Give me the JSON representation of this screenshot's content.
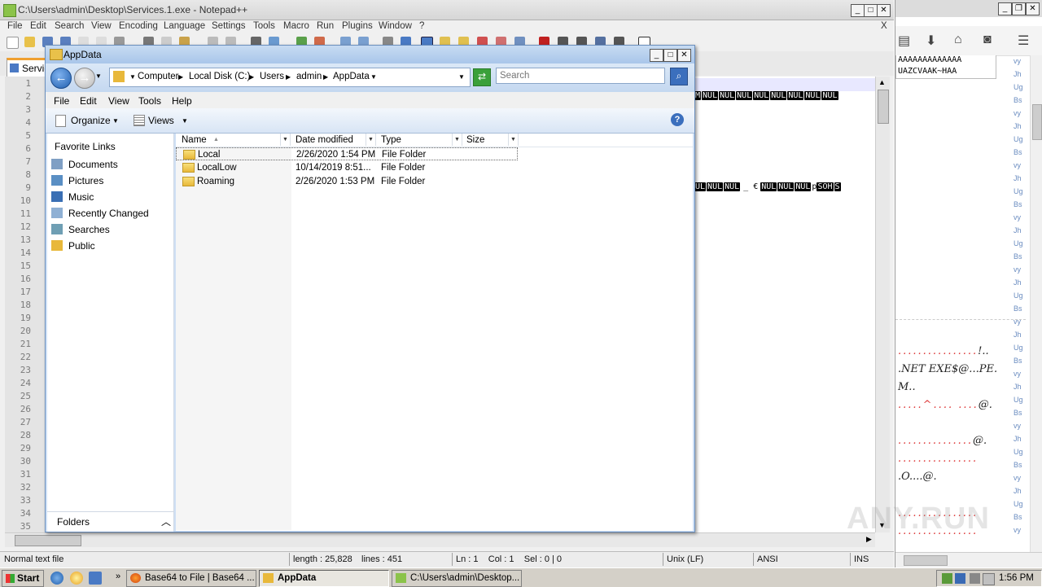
{
  "notepad": {
    "title": "C:\\Users\\admin\\Desktop\\Services.1.exe - Notepad++",
    "menu": [
      "File",
      "Edit",
      "Search",
      "View",
      "Encoding",
      "Language",
      "Settings",
      "Tools",
      "Macro",
      "Run",
      "Plugins",
      "Window",
      "?"
    ],
    "close_x": "X",
    "tab_label": "Servic",
    "line_numbers": [
      "1",
      "2",
      "3",
      "4",
      "5",
      "6",
      "7",
      "8",
      "9",
      "10",
      "11",
      "12",
      "13",
      "14",
      "15",
      "16",
      "17",
      "18",
      "19",
      "20",
      "21",
      "22",
      "23",
      "24",
      "25",
      "26",
      "27",
      "28",
      "29",
      "30",
      "31",
      "32",
      "33",
      "34",
      "35"
    ],
    "line2_control_chars": [
      "NUL",
      "NUL",
      "NUL",
      "NUL",
      "NUL",
      "NUL",
      "NUL",
      "NUL"
    ],
    "line2_prefix": "M",
    "line9_control_chars": [
      "UL",
      "NUL",
      "NUL"
    ],
    "line9_text_mid": "_ €",
    "line9_control_chars_2": [
      "NUL",
      "NUL",
      "NUL"
    ],
    "line9_text_tail": "p",
    "line9_control_chars_3": [
      "SOH",
      "S"
    ],
    "status": {
      "file_type": "Normal text file",
      "length": "length : 25,828",
      "lines": "lines : 451",
      "position": "Ln : 1    Col : 1    Sel : 0 | 0",
      "eol": "Unix (LF)",
      "encoding": "ANSI",
      "mode": "INS"
    }
  },
  "right_panel": {
    "top_lines": [
      "AAAAAAAAAAAAA",
      "UAZCVAAK~HAA"
    ],
    "hex_lines": [
      {
        "dots": "................",
        "text": "!.."
      },
      {
        "dots": "",
        "text": ".NET EXE$@...PE."
      },
      {
        "dots": "",
        "text": "M.."
      },
      {
        "dots": ".....^....  ....",
        "text": "@."
      },
      {
        "dots": "...............",
        "text": "@."
      },
      {
        "dots": "................",
        "text": ""
      },
      {
        "dots": "",
        "text": ".O....@."
      },
      {
        "dots": "................",
        "text": ""
      },
      {
        "dots": "................",
        "text": ""
      }
    ],
    "b64_chars": [
      "vy",
      "Jh",
      "Ug",
      "Bs",
      "vy",
      "Jh",
      "Ug",
      "Bs",
      "vy",
      "Jh",
      "Ug",
      "Bs",
      "vy",
      "Jh",
      "Ug",
      "Bs",
      "vy",
      "Jh",
      "Ug",
      "Bs",
      "vy",
      "Jh",
      "Ug",
      "Bs",
      "vy",
      "Jh",
      "Ug",
      "Bs",
      "vy",
      "Jh",
      "Ug",
      "Bs",
      "vy",
      "Jh",
      "Ug",
      "Bs",
      "vy"
    ]
  },
  "explorer": {
    "title": "AppData",
    "breadcrumbs": [
      "Computer",
      "Local Disk (C:)",
      "Users",
      "admin",
      "AppData"
    ],
    "search_placeholder": "Search",
    "menu": [
      "File",
      "Edit",
      "View",
      "Tools",
      "Help"
    ],
    "toolbar": {
      "organize": "Organize",
      "views": "Views"
    },
    "nav": {
      "header": "Favorite Links",
      "items": [
        "Documents",
        "Pictures",
        "Music",
        "Recently Changed",
        "Searches",
        "Public"
      ],
      "folders_label": "Folders"
    },
    "columns": [
      "Name",
      "Date modified",
      "Type",
      "Size"
    ],
    "rows": [
      {
        "name": "Local",
        "date": "2/26/2020 1:54 PM",
        "type": "File Folder",
        "size": ""
      },
      {
        "name": "LocalLow",
        "date": "10/14/2019 8:51...",
        "type": "File Folder",
        "size": ""
      },
      {
        "name": "Roaming",
        "date": "2/26/2020 1:53 PM",
        "type": "File Folder",
        "size": ""
      }
    ]
  },
  "taskbar": {
    "start": "Start",
    "buttons": [
      "Base64 to File | Base64 ...",
      "AppData",
      "C:\\Users\\admin\\Desktop..."
    ],
    "clock": "1:56 PM"
  },
  "watermark": "ANY.RUN",
  "colors": {
    "accent": "#3b6fbd",
    "folder": "#e8b83a",
    "control_char_bg": "#000000",
    "dot_red": "#dd3333"
  }
}
